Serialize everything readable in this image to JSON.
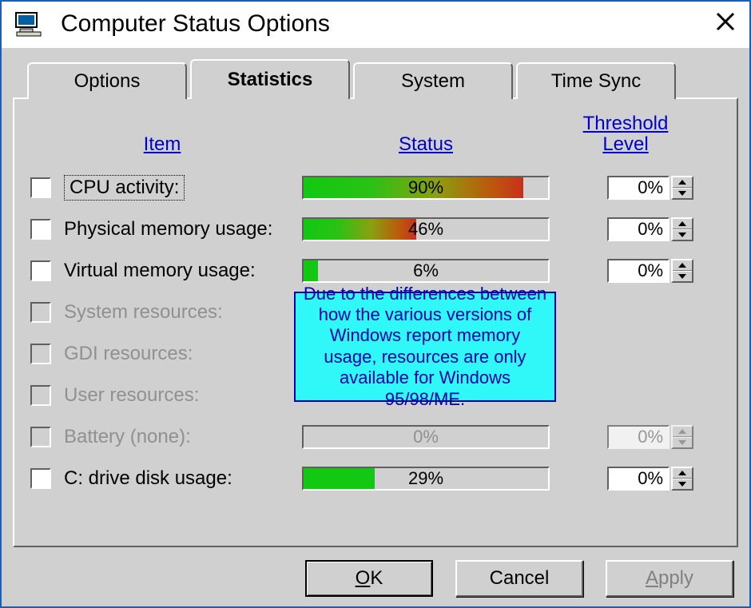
{
  "window": {
    "title": "Computer Status Options"
  },
  "tabs": [
    {
      "label": "Options",
      "active": false
    },
    {
      "label": "Statistics",
      "active": true
    },
    {
      "label": "System",
      "active": false
    },
    {
      "label": "Time Sync",
      "active": false
    }
  ],
  "columns": {
    "item": "Item",
    "status": "Status",
    "threshold_line1": "Threshold",
    "threshold_line2": "Level"
  },
  "rows": [
    {
      "label": "CPU activity:",
      "enabled": true,
      "focus": true,
      "pct": "90%",
      "fill": 90,
      "gradient": true,
      "threshold": "0%"
    },
    {
      "label": "Physical memory usage:",
      "enabled": true,
      "focus": false,
      "pct": "46%",
      "fill": 46,
      "gradient": true,
      "threshold": "0%"
    },
    {
      "label": "Virtual memory usage:",
      "enabled": true,
      "focus": false,
      "pct": "6%",
      "fill": 6,
      "gradient": false,
      "threshold": "0%"
    },
    {
      "label": "System resources:",
      "enabled": false,
      "focus": false,
      "pct": "",
      "fill": 0,
      "gradient": false,
      "threshold": ""
    },
    {
      "label": "GDI resources:",
      "enabled": false,
      "focus": false,
      "pct": "",
      "fill": 0,
      "gradient": false,
      "threshold": ""
    },
    {
      "label": "User resources:",
      "enabled": false,
      "focus": false,
      "pct": "",
      "fill": 0,
      "gradient": false,
      "threshold": ""
    },
    {
      "label": "Battery (none):",
      "enabled": false,
      "focus": false,
      "pct": "0%",
      "fill": 0,
      "gradient": false,
      "threshold": "0%"
    },
    {
      "label": "C: drive disk usage:",
      "enabled": true,
      "focus": false,
      "pct": "29%",
      "fill": 29,
      "gradient": false,
      "threshold": "0%"
    }
  ],
  "info_overlay": "Due to the differences between how the various versions of Windows report memory usage, resources are only available for Windows 95/98/ME.",
  "buttons": {
    "ok_pre": "",
    "ok_ul": "O",
    "ok_post": "K",
    "cancel": "Cancel",
    "apply_pre": "",
    "apply_ul": "A",
    "apply_post": "pply"
  }
}
